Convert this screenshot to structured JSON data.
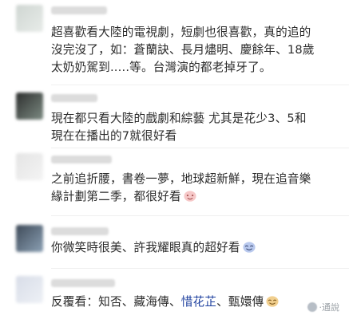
{
  "comments": [
    {
      "lines": [
        "超喜歡看大陸的電視劇，短劇也很喜歡，真的追的",
        "沒完沒了，如：蒼蘭訣、長月燼明、慶餘年、18歲",
        "太奶奶駕到.....等。台灣演的都老掉牙了。"
      ]
    },
    {
      "lines": [
        "現在都只看大陸的戲劇和綜藝 尤其是花少3、5和",
        "現在在播出的7就很好看"
      ]
    },
    {
      "lines": [
        "之前追折腰，書卷一夢，地球超新鮮，現在追音樂",
        "緣計劃第二季，都很好看"
      ],
      "emoji": "happy-face-emoji"
    },
    {
      "lines": [
        "你微笑時很美、許我耀眼真的超好看"
      ],
      "emoji": "smiling-face-emoji"
    },
    {
      "segments": [
        "反覆看：知否、藏海傳、",
        "惜花芷",
        "、甄嬛傳"
      ],
      "emoji": "smiling-face-emoji"
    }
  ],
  "watermark": {
    "text": "·通說"
  },
  "colors": {
    "text": "#2b2b2b",
    "highlight": "#1d3f9e",
    "watermark": "#9aa0a6"
  }
}
